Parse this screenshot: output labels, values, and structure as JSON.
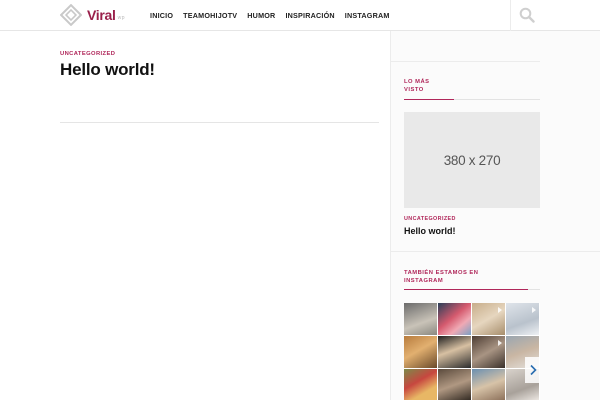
{
  "header": {
    "logo_text": "Viral",
    "logo_sub": "wp",
    "nav": [
      "INICIO",
      "TEAMOHIJOTV",
      "HUMOR",
      "INSPIRACIÓN",
      "INSTAGRAM"
    ]
  },
  "article": {
    "category": "UNCATEGORIZED",
    "title": "Hello world!"
  },
  "sidebar": {
    "most_viewed": {
      "title_line1": "LO MÁS",
      "title_line2": "VISTO",
      "thumbnail_label": "380 x 270",
      "post_category": "UNCATEGORIZED",
      "post_title": "Hello world!"
    },
    "instagram": {
      "title_line1": "TAMBIÉN ESTAMOS EN",
      "title_line2": "INSTAGRAM"
    }
  },
  "colors": {
    "accent": "#b0275a",
    "logo": "#9a1f4a",
    "sidebar_bg": "#fbfbfb",
    "thumb_bg": "#e9e9e9"
  },
  "instagram_tiles": [
    {
      "bg": "linear-gradient(160deg,#6b6b6b,#c9c3b8 60%,#8a8880)",
      "video": false
    },
    {
      "bg": "linear-gradient(140deg,#2a3f58,#d55a6e 45%,#f0a9b4 70%,#7aa0c4)",
      "video": false
    },
    {
      "bg": "linear-gradient(150deg,#c7ad8a,#e6d6bf 50%,#a78e6c)",
      "video": true
    },
    {
      "bg": "linear-gradient(160deg,#dfe4ea,#b9c2cc 60%,#eef1f4)",
      "video": true
    },
    {
      "bg": "linear-gradient(150deg,#b77b3d,#e2b070 45%,#6a4a2a)",
      "video": false
    },
    {
      "bg": "linear-gradient(160deg,#1e1e1e,#d7c0a2 45%,#2b2b2b)",
      "video": false
    },
    {
      "bg": "linear-gradient(150deg,#4d3d33,#a89483 50%,#3a302a)",
      "video": true
    },
    {
      "bg": "linear-gradient(160deg,#9aa6b1,#c9b6a3 50%,#e4e1dc)",
      "video": false
    },
    {
      "bg": "linear-gradient(150deg,#7b8a4a,#c7473f 40%,#e8b765 70%)",
      "video": false
    },
    {
      "bg": "linear-gradient(160deg,#5a4a3c,#b09882 50%,#2e261f)",
      "video": false
    },
    {
      "bg": "linear-gradient(160deg,#6a8fb0,#d7c3a8 50%,#8a6e58)",
      "video": false
    },
    {
      "bg": "linear-gradient(160deg,#d9d3cc,#a8a19a 60%,#efeae5)",
      "video": false
    }
  ]
}
